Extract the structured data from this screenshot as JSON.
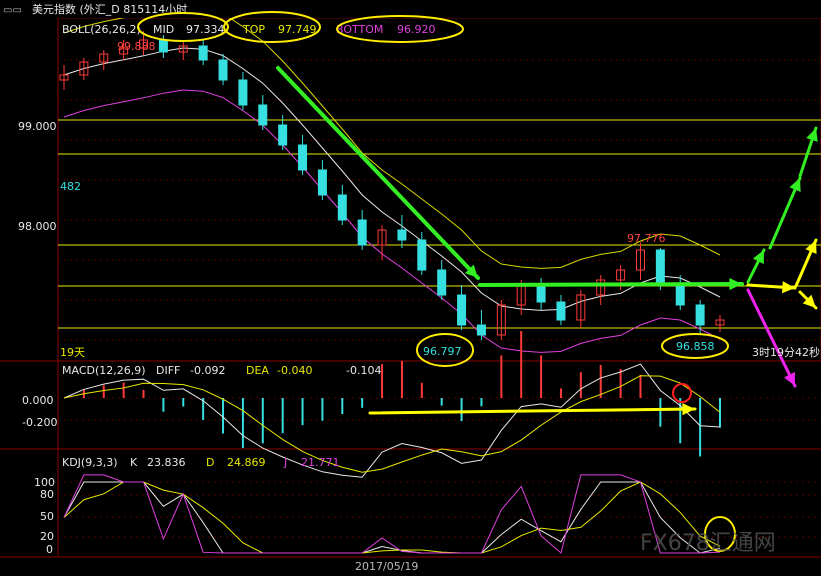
{
  "title_bar": {
    "text": "美元指数 (外汇_D 815114小时"
  },
  "boll": {
    "label": "BOLL(26,26,2)",
    "mid_label": "MID",
    "mid_value": "97.334",
    "top_label": "TOP",
    "top_value": "97.749",
    "bottom_label": "BOTTOM",
    "bottom_value": "96.920"
  },
  "price_axis": [
    "99.000",
    "98.000"
  ],
  "annotations": {
    "high": "99.888",
    "left_low": "482",
    "low1": "96.797",
    "peak2": "97.776",
    "low2": "96.858",
    "days": "19天",
    "countdown": "3时19分42秒"
  },
  "macd": {
    "label": "MACD(12,26,9)",
    "diff_label": "DIFF",
    "diff_value": "-0.092",
    "dea_label": "DEA",
    "dea_value": "-0.040",
    "macd_value": "-0.104",
    "axis": [
      "0.000",
      "-0.200"
    ]
  },
  "kdj": {
    "label": "KDJ(9,3,3)",
    "k_label": "K",
    "k_value": "23.836",
    "d_label": "D",
    "d_value": "24.869",
    "j_label": "J",
    "j_value": "21.771",
    "axis": [
      "100",
      "80",
      "50",
      "20",
      "0"
    ]
  },
  "date_label": "2017/05/19",
  "watermark": "FX678汇通网",
  "colors": {
    "up": "#ff3a3a",
    "down": "#36e0e0",
    "mid": "#e8e8e8",
    "top_band": "#d8d800",
    "bottom_band": "#e040e0",
    "hline": "#e8e800",
    "arrow_green": "#33ee22",
    "arrow_yellow": "#ffff00",
    "arrow_magenta": "#ee22ee",
    "circle": "#ffee00",
    "circle_red": "#ff2020"
  },
  "chart_data": {
    "type": "candlestick",
    "timeframe": "hourly",
    "instrument": "美元指数",
    "ylim": [
      96.6,
      100.0
    ],
    "horizontal_levels": [
      99.0,
      98.66,
      97.75,
      97.34,
      96.92
    ],
    "candles_ohlc": [
      [
        99.4,
        99.55,
        99.3,
        99.45
      ],
      [
        99.45,
        99.62,
        99.4,
        99.58
      ],
      [
        99.58,
        99.7,
        99.5,
        99.66
      ],
      [
        99.66,
        99.8,
        99.6,
        99.72
      ],
      [
        99.72,
        99.888,
        99.65,
        99.8
      ],
      [
        99.8,
        99.85,
        99.62,
        99.68
      ],
      [
        99.68,
        99.78,
        99.6,
        99.74
      ],
      [
        99.74,
        99.8,
        99.55,
        99.6
      ],
      [
        99.6,
        99.66,
        99.35,
        99.4
      ],
      [
        99.4,
        99.48,
        99.1,
        99.15
      ],
      [
        99.15,
        99.25,
        98.9,
        98.95
      ],
      [
        98.95,
        99.05,
        98.7,
        98.75
      ],
      [
        98.75,
        98.85,
        98.45,
        98.5
      ],
      [
        98.5,
        98.6,
        98.2,
        98.25
      ],
      [
        98.25,
        98.35,
        97.95,
        98.0
      ],
      [
        98.0,
        98.1,
        97.7,
        97.75
      ],
      [
        97.75,
        97.95,
        97.6,
        97.9
      ],
      [
        97.9,
        98.05,
        97.72,
        97.8
      ],
      [
        97.8,
        97.88,
        97.45,
        97.5
      ],
      [
        97.5,
        97.6,
        97.2,
        97.25
      ],
      [
        97.25,
        97.35,
        96.9,
        96.95
      ],
      [
        96.95,
        97.1,
        96.797,
        96.85
      ],
      [
        96.85,
        97.2,
        96.8,
        97.15
      ],
      [
        97.15,
        97.4,
        97.05,
        97.35
      ],
      [
        97.35,
        97.42,
        97.1,
        97.18
      ],
      [
        97.18,
        97.25,
        96.95,
        97.0
      ],
      [
        97.0,
        97.3,
        96.92,
        97.25
      ],
      [
        97.25,
        97.45,
        97.15,
        97.4
      ],
      [
        97.4,
        97.55,
        97.3,
        97.5
      ],
      [
        97.5,
        97.776,
        97.4,
        97.7
      ],
      [
        97.7,
        97.72,
        97.3,
        97.35
      ],
      [
        97.35,
        97.45,
        97.1,
        97.15
      ],
      [
        97.15,
        97.2,
        96.858,
        96.95
      ],
      [
        96.95,
        97.05,
        96.88,
        97.0
      ]
    ],
    "boll_params": [
      26,
      26,
      2
    ],
    "macd": {
      "params": [
        12,
        26,
        9
      ],
      "diff": -0.092,
      "dea": -0.04,
      "macd": -0.104
    },
    "kdj": {
      "params": [
        9,
        3,
        3
      ],
      "k": 23.836,
      "d": 24.869,
      "j": 21.771
    },
    "x_label": "2017/05/19"
  }
}
